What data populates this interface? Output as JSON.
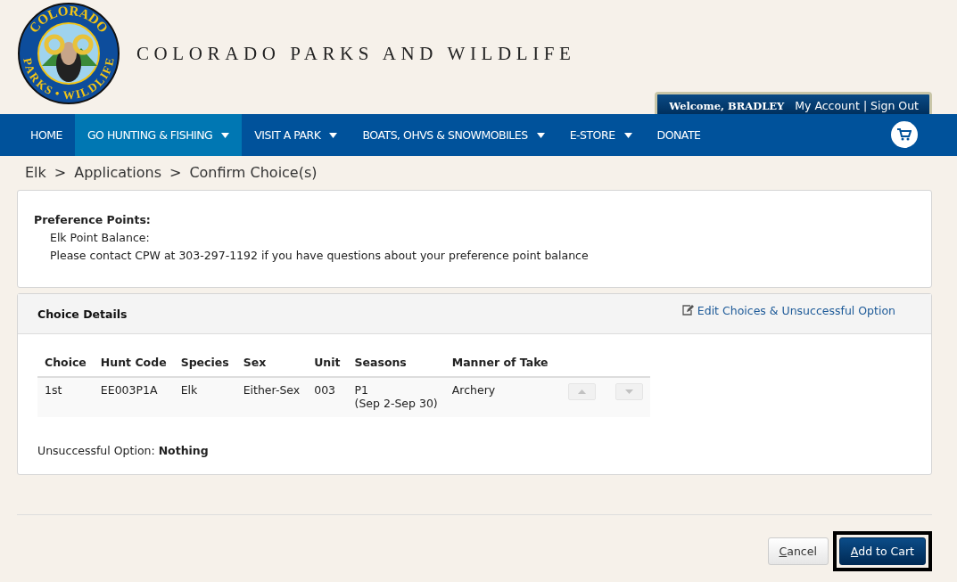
{
  "logo": {
    "top_text": "COLORADO",
    "bottom_text": "PARKS • WILDLIFE"
  },
  "site_title": "COLORADO PARKS AND WILDLIFE",
  "account": {
    "welcome": "Welcome, BRADLEY",
    "links": [
      "My Account",
      "|",
      "Sign Out"
    ]
  },
  "nav": [
    {
      "label": "HOME",
      "selected": false,
      "dropdown": false
    },
    {
      "label": "GO HUNTING & FISHING",
      "selected": true,
      "dropdown": true
    },
    {
      "label": "VISIT A PARK",
      "selected": false,
      "dropdown": true
    },
    {
      "label": "BOATS, OHVS & SNOWMOBILES",
      "selected": false,
      "dropdown": true
    },
    {
      "label": "E-STORE",
      "selected": false,
      "dropdown": true
    },
    {
      "label": "DONATE",
      "selected": false,
      "dropdown": false
    }
  ],
  "breadcrumb": [
    "Elk",
    ">",
    "Applications",
    ">",
    "Confirm Choice(s)"
  ],
  "preference": {
    "heading": "Preference Points:",
    "lines": [
      "Elk Point Balance:",
      "Please contact CPW at 303-297-1192 if you have questions about your preference point balance"
    ]
  },
  "choice_details": {
    "title": "Choice Details",
    "edit_link": "Edit Choices & Unsuccessful Option",
    "columns": [
      "Choice",
      "Hunt Code",
      "Species",
      "Sex",
      "Unit",
      "Seasons",
      "Manner of Take"
    ],
    "rows": [
      {
        "cells": [
          "1st",
          "EE003P1A",
          "Elk",
          "Either-Sex",
          "003",
          [
            "P1",
            "(Sep 2-Sep 30)"
          ],
          "Archery"
        ],
        "up_disabled": true,
        "down_disabled": true
      }
    ],
    "unsuccessful": "Unsuccessful Option: **Nothing**"
  },
  "buttons": [
    {
      "label": "Cancel",
      "kind": "secondary",
      "highlighted": false
    },
    {
      "label": "Add to Cart",
      "kind": "primary",
      "highlighted": true
    }
  ]
}
